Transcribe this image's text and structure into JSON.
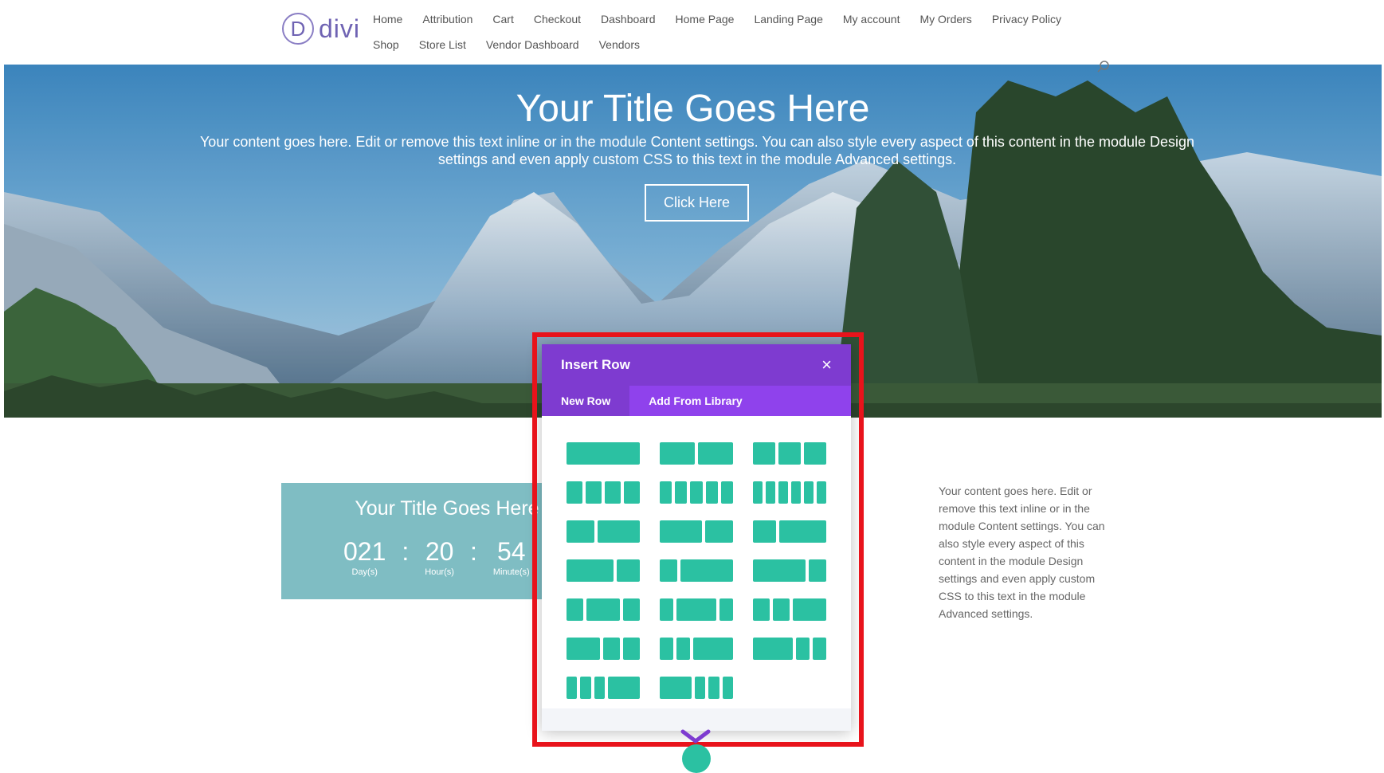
{
  "header": {
    "logo_letter": "D",
    "logo_text": "divi",
    "nav": [
      "Home",
      "Attribution",
      "Cart",
      "Checkout",
      "Dashboard",
      "Home Page",
      "Landing Page",
      "My account",
      "My Orders",
      "Privacy Policy",
      "Shop",
      "Store List",
      "Vendor Dashboard",
      "Vendors"
    ],
    "search_icon": "search-icon"
  },
  "hero": {
    "title": "Your Title Goes Here",
    "body": "Your content goes here. Edit or remove this text inline or in the module Content settings. You can also style every aspect of this content in the module Design settings and even apply custom CSS to this text in the module Advanced settings.",
    "button": "Click Here"
  },
  "countdown_card": {
    "title": "Your Title Goes Here",
    "units": [
      {
        "value": "021",
        "label": "Day(s)"
      },
      {
        "value": "20",
        "label": "Hour(s)"
      },
      {
        "value": "54",
        "label": "Minute(s)"
      }
    ],
    "separator": ":"
  },
  "side_text": "Your content goes here. Edit or remove this text inline or in the module Content settings. You can also style every aspect of this content in the module Design settings and even apply custom CSS to this text in the module Advanced settings.",
  "modal": {
    "title": "Insert Row",
    "close": "×",
    "tabs": [
      {
        "label": "New Row",
        "active": true
      },
      {
        "label": "Add From Library",
        "active": false
      }
    ],
    "row_layouts": [
      "1",
      "1/2 + 1/2",
      "1/3 + 1/3 + 1/3",
      "1/4 + 1/4 + 1/4 + 1/4",
      "1/5 + 1/5 + 1/5 + 1/5 + 1/5",
      "1/6 + 1/6 + 1/6 + 1/6 + 1/6 + 1/6",
      "2/5 + 3/5",
      "3/5 + 2/5",
      "1/3 + 2/3",
      "2/3 + 1/3",
      "1/4 + 3/4",
      "3/4 + 1/4",
      "1/4 + 1/2 + 1/4",
      "1/5 + 3/5 + 1/5",
      "1/4 + 1/4 + 1/2",
      "1/2 + 1/4 + 1/4",
      "1/5 + 1/5 + 3/5",
      "3/5 + 1/5 + 1/5",
      "1/6 + 1/6 + 1/6 + 1/2",
      "1/2 + 1/6 + 1/6 + 1/6"
    ],
    "accent_color": "#7e3bd0",
    "column_color": "#2bc1a2"
  },
  "highlight_color": "#e8131b"
}
